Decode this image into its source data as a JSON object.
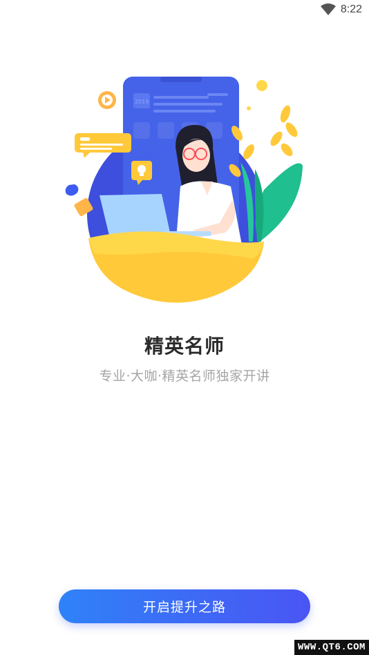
{
  "status_bar": {
    "time": "8:22",
    "wifi_icon": "wifi-icon"
  },
  "illustration": {
    "phone_label": "2019",
    "icons": [
      "play-icon",
      "chat-bubble-icon",
      "lightbulb-icon",
      "coffee-cup-icon",
      "laptop-icon",
      "plant-icon"
    ],
    "colors": {
      "blue": "#3d4fdc",
      "yellow": "#ffc93a",
      "green": "#1fbf8f",
      "orange": "#ffb547"
    }
  },
  "onboarding": {
    "title": "精英名师",
    "subtitle": "专业·大咖·精英名师独家开讲",
    "button_label": "开启提升之路"
  },
  "watermark": {
    "text": "WWW.QT6.COM"
  },
  "colors": {
    "button_start": "#2f82f8",
    "button_end": "#4a55f3",
    "title": "#2b2b2b",
    "subtitle": "#a5a5a5"
  }
}
